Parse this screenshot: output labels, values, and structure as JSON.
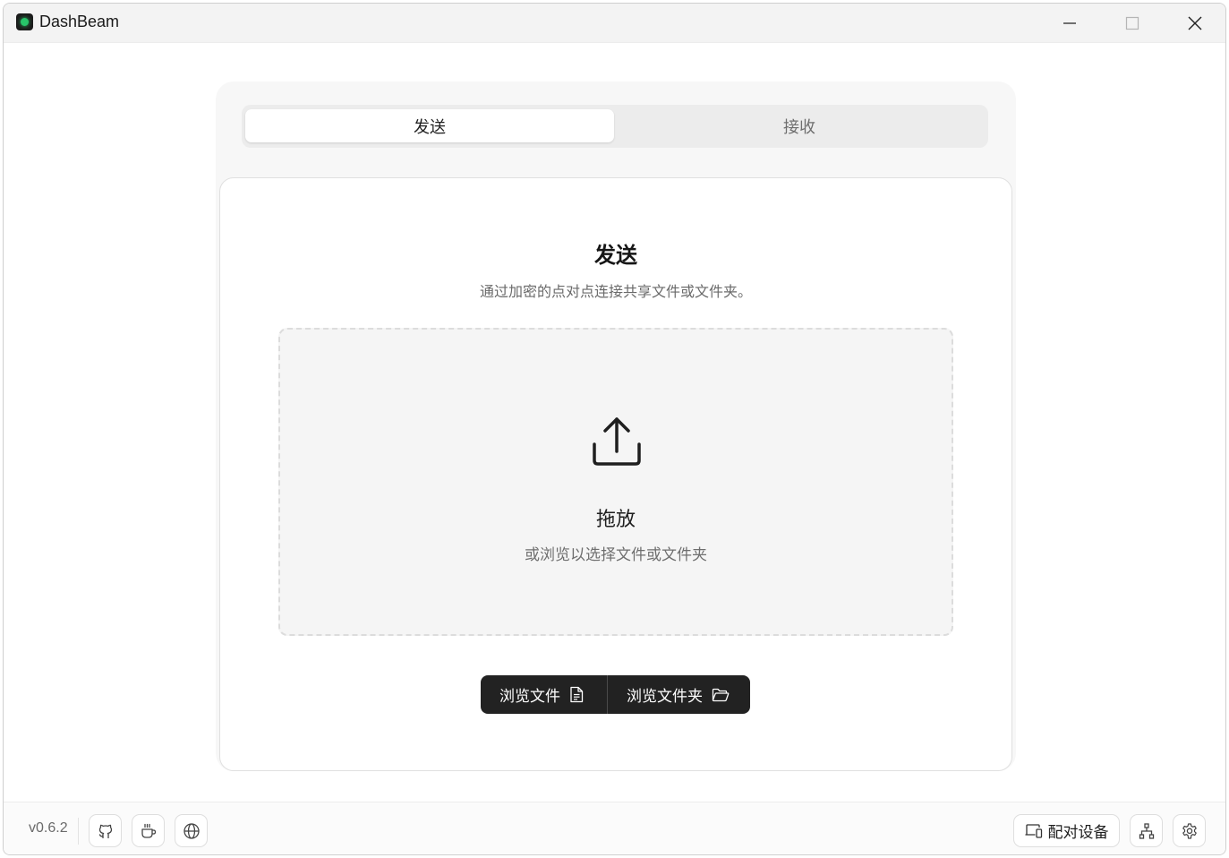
{
  "window": {
    "title": "DashBeam",
    "controls": [
      "minimize",
      "maximize",
      "close"
    ]
  },
  "tabs": [
    {
      "label": "发送",
      "active": true
    },
    {
      "label": "接收",
      "active": false
    }
  ],
  "send": {
    "title": "发送",
    "subtitle": "通过加密的点对点连接共享文件或文件夹。",
    "dropzone": {
      "icon": "upload-icon",
      "title": "拖放",
      "subtitle": "或浏览以选择文件或文件夹"
    },
    "buttons": {
      "browse_files": "浏览文件",
      "browse_folder": "浏览文件夹"
    }
  },
  "footer": {
    "version": "v0.6.2",
    "left_icons": [
      "github-icon",
      "coffee-icon",
      "globe-icon"
    ],
    "pair_label": "配对设备",
    "right_icons": [
      "network-icon",
      "settings-icon"
    ]
  },
  "colors": {
    "accent_dark": "#222222",
    "app_icon_glow": "#28c46a"
  }
}
